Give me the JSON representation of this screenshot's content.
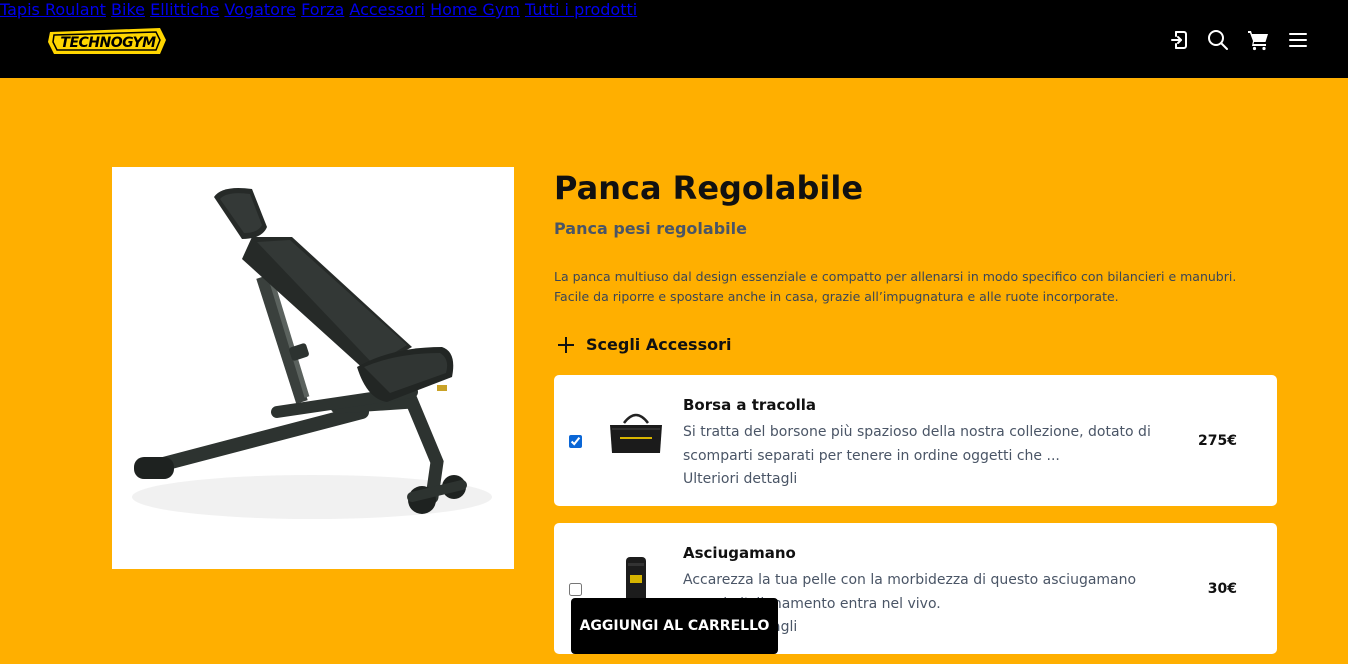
{
  "header": {
    "logo_text": "TECHNOGYM",
    "nav": [
      "Tapis Roulant",
      "Bike",
      "Ellittiche",
      "Vogatore",
      "Forza",
      "Accessori",
      "Home Gym",
      "Tutti i prodotti"
    ],
    "icons": [
      "login-icon",
      "search-icon",
      "cart-icon",
      "menu-icon"
    ]
  },
  "product": {
    "title": "Panca Regolabile",
    "subtitle": "Panca pesi regolabile",
    "description": "La panca multiuso dal design essenziale e compatto per allenarsi in modo specifico con bilancieri e manubri. Facile da riporre e spostare anche in casa, grazie all’impugnatura e alle ruote incorporate."
  },
  "accessories": {
    "header": "Scegli Accessori",
    "items": [
      {
        "name": "Borsa a tracolla",
        "description": "Si tratta del borsone più spazioso della nostra collezione, dotato di scomparti separati per tenere in ordine oggetti che ...",
        "more": "Ulteriori dettagli",
        "price": "275€",
        "checked": true
      },
      {
        "name": "Asciugamano",
        "description": "Accarezza la tua pelle con la morbidezza di questo asciugamano quando l'allenamento entra nel vivo.",
        "more": "Ulteriori dettagli",
        "price": "30€",
        "checked": false
      }
    ]
  },
  "cart_button": "AGGIUNGI AL CARRELLO",
  "colors": {
    "background": "#FFAF00",
    "header": "#000000",
    "accent_logo": "#FFD600"
  }
}
